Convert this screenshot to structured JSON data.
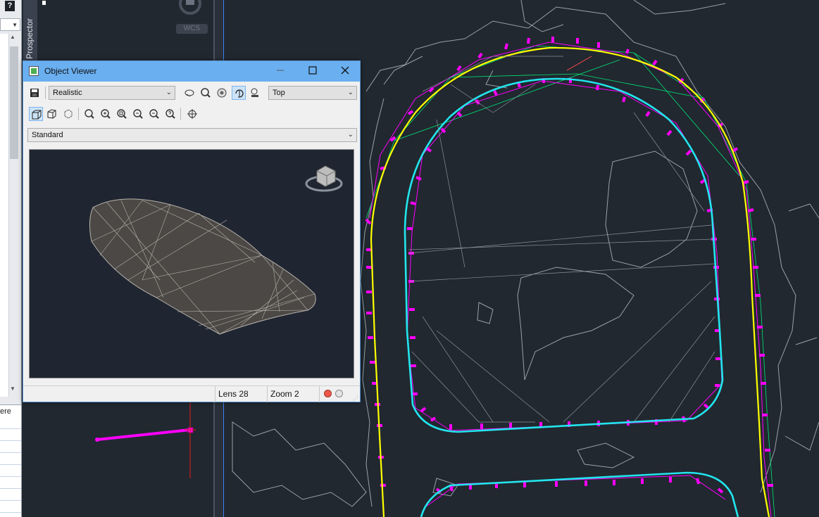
{
  "app": {
    "help_label": "?"
  },
  "left_panel": {
    "grid_header": "ere"
  },
  "prospector": {
    "label": "Prospector"
  },
  "viewcube": {
    "wcs_label": "WCS"
  },
  "object_viewer": {
    "title": "Object Viewer",
    "visual_style": "Realistic",
    "view_direction": "Top",
    "view_type": "Standard",
    "lens_label": "Lens 28",
    "zoom_label": "Zoom 2",
    "colors": {
      "titlebar": "#6aaff0",
      "canvas": "#202631",
      "surface": "#4b4845"
    }
  },
  "drawing": {
    "colors": {
      "background": "#212830",
      "contours": "#9aa0a8",
      "feature_lines": "#ff00ff",
      "edge_of_pavement": "#ffff00",
      "curb": "#22e5ee",
      "triangulation": "#00e676",
      "crosshair": "#e11d1d"
    }
  }
}
